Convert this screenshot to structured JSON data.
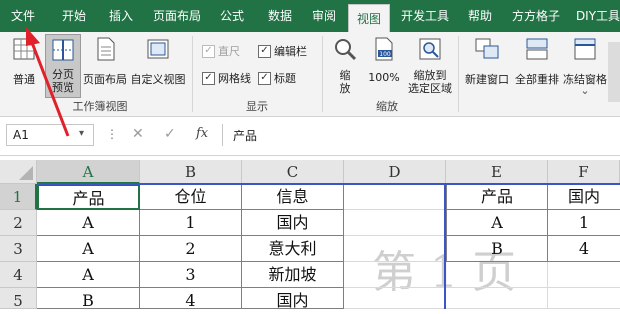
{
  "tabs": [
    "文件",
    "开始",
    "插入",
    "页面布局",
    "公式",
    "数据",
    "审阅",
    "视图",
    "开发工具",
    "帮助",
    "方方格子",
    "DIY工具箱"
  ],
  "active_tab": "视图",
  "ribbon": {
    "workbook_views": {
      "group_label": "工作簿视图",
      "normal": "普通",
      "page_break_line1": "分页",
      "page_break_line2": "预览",
      "page_layout": "页面布局",
      "custom_views": "自定义视图"
    },
    "show": {
      "group_label": "显示",
      "ruler": "直尺",
      "formula_bar": "编辑栏",
      "gridlines": "网格线",
      "headings": "标题",
      "check_mark": "✓"
    },
    "zoom": {
      "group_label": "缩放",
      "zoom_line1": "缩",
      "zoom_line2": "放",
      "zoom_100": "100%",
      "zoom_100_icon_text": "100",
      "zoom_sel_line1": "缩放到",
      "zoom_sel_line2": "选定区域"
    },
    "window": {
      "new_window": "新建窗口",
      "arrange_all": "全部重排",
      "freeze_panes": "冻结窗格",
      "dropdown_glyph": "⌄"
    }
  },
  "formula_bar": {
    "name_box": "A1",
    "cancel_glyph": "✕",
    "enter_glyph": "✓",
    "fx": "fx",
    "content": "产品",
    "dropdown_glyph": "▾",
    "dots": "⋮"
  },
  "sheet": {
    "columns": [
      "A",
      "B",
      "C",
      "D",
      "E",
      "F"
    ],
    "rows": [
      "1",
      "2",
      "3",
      "4",
      "5"
    ],
    "cells": [
      [
        "产品",
        "仓位",
        "信息",
        "",
        "产品",
        "国内"
      ],
      [
        "A",
        "1",
        "国内",
        "",
        "A",
        "1"
      ],
      [
        "A",
        "2",
        "意大利",
        "",
        "B",
        "4"
      ],
      [
        "A",
        "3",
        "新加坡",
        "",
        "",
        ""
      ],
      [
        "B",
        "4",
        "国内",
        "",
        "",
        ""
      ]
    ],
    "page_watermark": "第 1 页"
  },
  "colors": {
    "accent": "#217346",
    "annotation_arrow": "#e0202a"
  }
}
